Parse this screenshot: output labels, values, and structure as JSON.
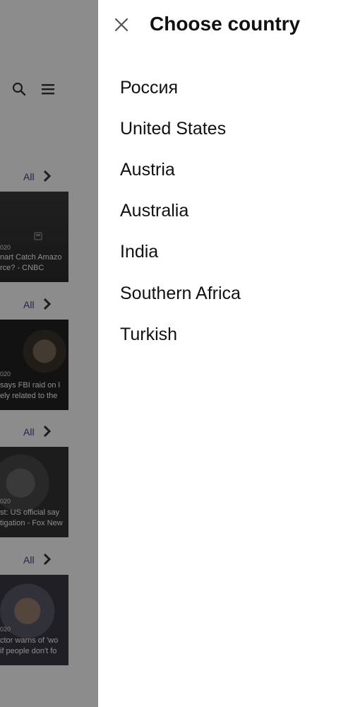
{
  "background": {
    "sections": [
      {
        "all_label": "All",
        "date": "020",
        "title_lines": [
          "nart Catch Amazo",
          "rce? - CNBC"
        ]
      },
      {
        "all_label": "All",
        "date": "020",
        "title_lines": [
          "says FBI raid on l",
          "ely related to the"
        ]
      },
      {
        "all_label": "All",
        "date": "020",
        "title_lines": [
          "st: US official say",
          "tigation - Fox New"
        ]
      },
      {
        "all_label": "All",
        "date": "020",
        "title_lines": [
          "ctor warns of 'wo",
          "if people don't fo"
        ]
      }
    ]
  },
  "drawer": {
    "title": "Choose country",
    "countries": [
      "Россия",
      "United States",
      "Austria",
      "Australia",
      "India",
      "Southern Africa",
      "Turkish"
    ]
  },
  "colors": {
    "accent": "#4a3a8a",
    "text": "#111111",
    "scrim": "rgba(0,0,0,0.45)"
  },
  "icons": {
    "close": "close-icon",
    "search": "search-icon",
    "menu": "menu-icon",
    "chevron": "chevron-right-icon"
  }
}
